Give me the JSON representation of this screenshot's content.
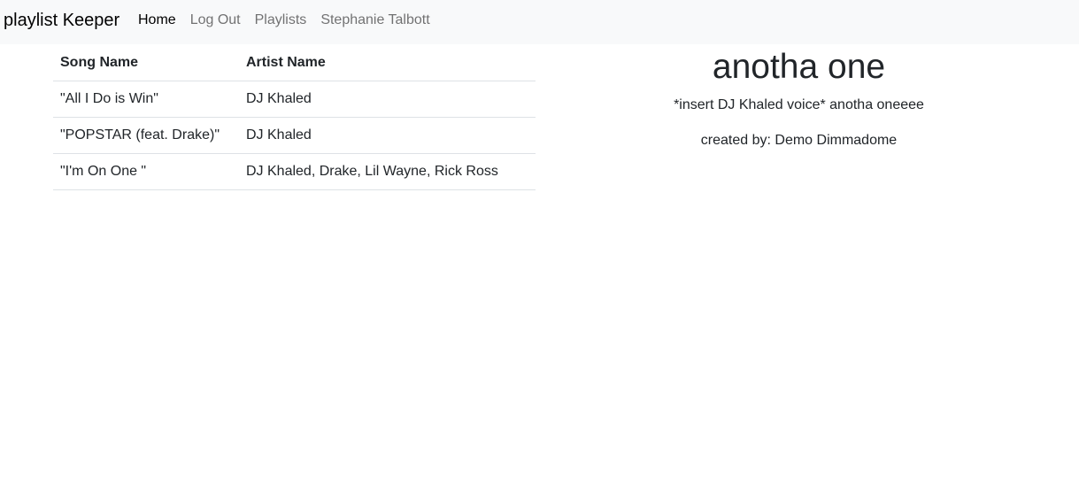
{
  "nav": {
    "brand": "playlist Keeper",
    "links": [
      {
        "label": "Home",
        "active": true
      },
      {
        "label": "Log Out",
        "active": false
      },
      {
        "label": "Playlists",
        "active": false
      },
      {
        "label": "Stephanie Talbott",
        "active": false
      }
    ]
  },
  "table": {
    "headers": [
      "Song Name",
      "Artist Name"
    ],
    "rows": [
      {
        "song": "\"All I Do is Win\"",
        "artist": "DJ Khaled"
      },
      {
        "song": "\"POPSTAR (feat. Drake)\"",
        "artist": "DJ Khaled"
      },
      {
        "song": "\"I'm On One \"",
        "artist": "DJ Khaled, Drake, Lil Wayne, Rick Ross"
      }
    ]
  },
  "playlist": {
    "title": "anotha one",
    "description": "*insert DJ Khaled voice* anotha oneeee",
    "creator": "created by: Demo Dimmadome"
  },
  "colors": {
    "navbar_bg": "#f8f9fa",
    "text": "#212529",
    "nav_inactive": "#6c757d",
    "border": "#dee2e6"
  }
}
